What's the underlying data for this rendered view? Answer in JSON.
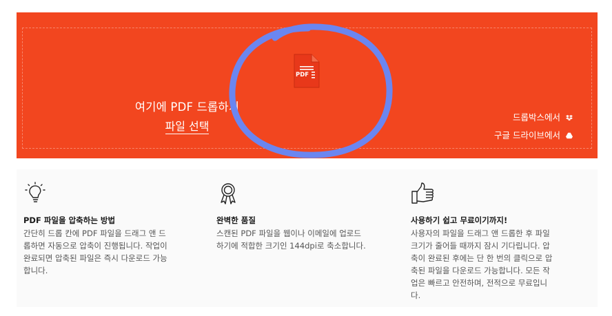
{
  "dropzone": {
    "icon_label": "PDF",
    "drop_text": "여기에 PDF 드롭하기",
    "select_file": "파일 선택",
    "dropbox": "드롭박스에서",
    "google_drive": "구글 드라이브에서",
    "accent_color": "#f2461f"
  },
  "features": [
    {
      "icon": "lightbulb-icon",
      "title": "PDF 파일을 압축하는 방법",
      "lines": [
        "간단히 드롭 칸에 PDF 파일을 드래그 앤 드",
        "롭하면 자동으로 압축이 진행됩니다. 작업이",
        "완료되면 압축된 파일은 즉시 다운로드 가능",
        "합니다."
      ]
    },
    {
      "icon": "award-ribbon-icon",
      "title": "완벽한 품질",
      "lines": [
        "스캔된 PDF 파일을 웹이나 이메일에 업로드",
        "하기에 적합한 크기인 144dpi로 축소합니다."
      ]
    },
    {
      "icon": "thumbs-up-icon",
      "title": "사용하기 쉽고 무료이기까지!",
      "lines": [
        "사용자의 파일을 드래그 앤 드롭한 후 파일",
        "크기가 줄어들 때까지 잠시 기다립니다. 압",
        "축이 완료된 후에는 단 한 번의 클릭으로 압",
        "축된 파일을 다운로드 가능합니다. 모든 작",
        "업은 빠르고 안전하며, 전적으로 무료입니",
        "다."
      ]
    }
  ]
}
